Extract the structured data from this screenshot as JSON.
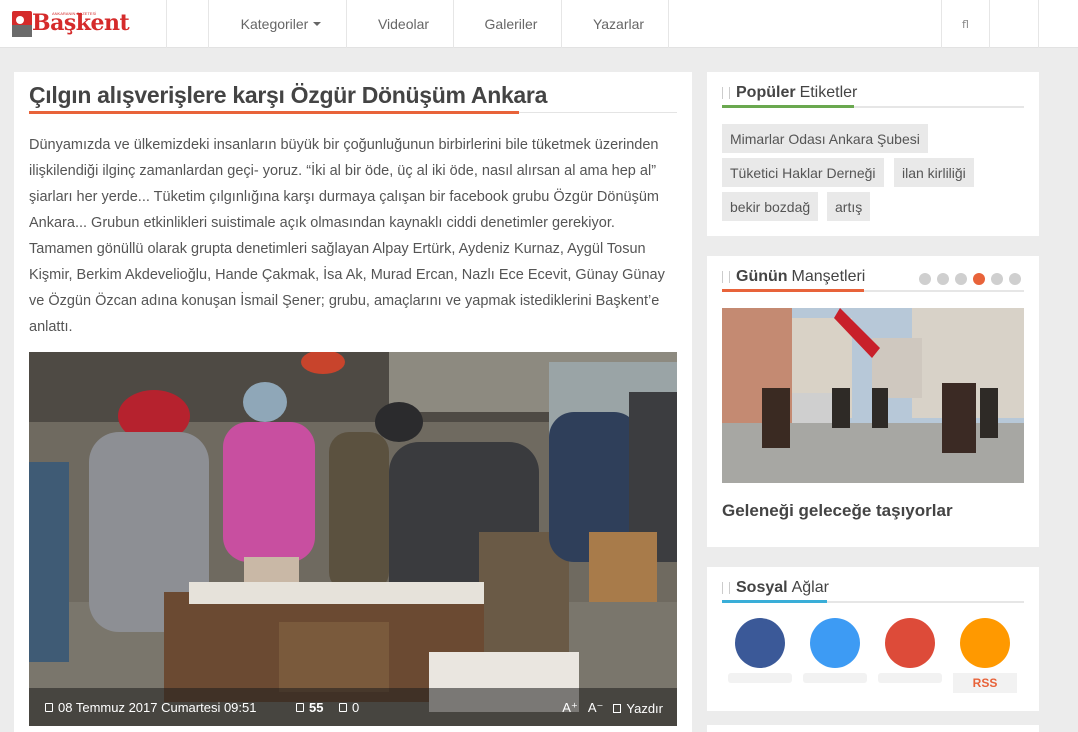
{
  "brand": {
    "name": "Başkent",
    "tagline": "ANKARANIN GAZETESİ",
    "color": "#d52b2b"
  },
  "nav": {
    "home_icon": "home-icon",
    "items": [
      {
        "label": "Kategoriler",
        "icon": "list-icon",
        "dropdown": true
      },
      {
        "label": "Videolar",
        "icon": "video-icon"
      },
      {
        "label": "Galeriler",
        "icon": "image-icon"
      },
      {
        "label": "Yazarlar",
        "icon": "user-icon"
      }
    ],
    "right_items": [
      {
        "glyph": "fl",
        "icon": "flag-icon"
      },
      {
        "glyph": "",
        "icon": "search-icon"
      }
    ],
    "icon_glyph": ""
  },
  "article": {
    "title": "Çılgın alışverişlere karşı Özgür Dönüşüm Ankara",
    "body": "Dünyamızda ve ülkemizdeki insanların büyük bir çoğunluğunun birbirlerini bile tüketmek üzerinden ilişkilendiği ilginç zamanlardan geçi- yoruz. “İki al bir öde, üç al iki öde, nasıl alırsan al ama hep al” şiarları her yerde... Tüketim çılgınlığına karşı durmaya çalışan bir facebook grubu Özgür Dönüşüm Ankara... Grubun etkinlikleri suistimale açık olmasından kaynaklı ciddi denetimler gerekiyor. Tamamen gönüllü olarak grupta denetimleri sağlayan Alpay Ertürk, Aydeniz Kurnaz, Aygül Tosun Kişmir, Berkim Akdevelioğlu, Hande Çakmak, İsa Ak, Murad Ercan, Nazlı Ece Ecevit, Günay Günay ve Özgün Özcan adına konuşan İsmail Şener; grubu, amaçlarını ve yapmak istediklerini Başkent’e anlattı.",
    "date": "08 Temmuz 2017 Cumartesi 09:51",
    "views": "55",
    "comments": "0",
    "font_up": "A⁺",
    "font_down": "A⁻",
    "print_label": "Yazdır",
    "accent": "#e8633a"
  },
  "popular_tags": {
    "title_strong": "Popüler",
    "title_rest": "Etiketler",
    "accent": "#6aa84f",
    "tags": [
      "Mimarlar Odası Ankara Şubesi",
      "Tüketici Haklar Derneği",
      "ilan kirliliği",
      "bekir bozdağ",
      "artış"
    ]
  },
  "headlines": {
    "title_strong": "Günün",
    "title_rest": "Manşetleri",
    "accent": "#e8633a",
    "dots": 6,
    "active_dot": 3,
    "news_title": "Geleneği geleceğe taşıyorlar"
  },
  "social": {
    "title_strong": "Sosyal",
    "title_rest": "Ağlar",
    "accent": "#3aaed8",
    "buttons": [
      {
        "name": "facebook",
        "icon": "facebook-icon",
        "color": "#3b5998"
      },
      {
        "name": "twitter",
        "icon": "twitter-icon",
        "color": "#3d9bf4"
      },
      {
        "name": "google-plus",
        "icon": "google-plus-icon",
        "color": "#dd4b39"
      },
      {
        "name": "rss",
        "icon": "rss-icon",
        "color": "#ff9900",
        "label": "RSS"
      }
    ]
  }
}
